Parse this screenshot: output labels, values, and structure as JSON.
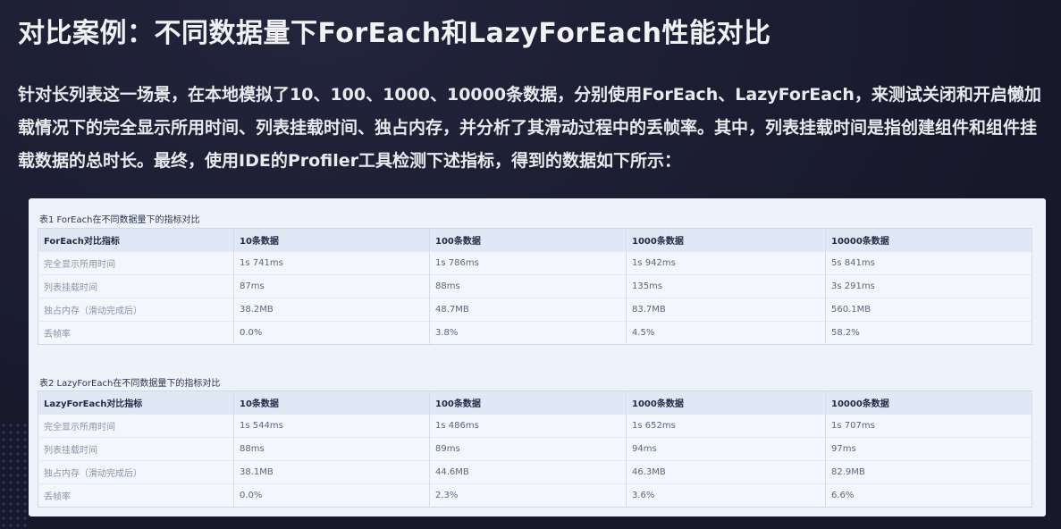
{
  "slide": {
    "title": "对比案例：不同数据量下ForEach和LazyForEach性能对比",
    "body": "针对长列表这一场景，在本地模拟了10、100、1000、10000条数据，分别使用ForEach、LazyForEach，来测试关闭和开启懒加载情况下的完全显示所用时间、列表挂载时间、独占内存，并分析了其滑动过程中的丢帧率。其中，列表挂载时间是指创建组件和组件挂载数据的总时长。最终，使用IDE的Profiler工具检测下述指标，得到的数据如下所示："
  },
  "tables": [
    {
      "caption": "表1 ForEach在不同数据量下的指标对比",
      "headers": [
        "ForEach对比指标",
        "10条数据",
        "100条数据",
        "1000条数据",
        "10000条数据"
      ],
      "rows": [
        [
          "完全显示所用时间",
          "1s 741ms",
          "1s 786ms",
          "1s 942ms",
          "5s 841ms"
        ],
        [
          "列表挂载时间",
          "87ms",
          "88ms",
          "135ms",
          "3s 291ms"
        ],
        [
          "独占内存（滑动完成后）",
          "38.2MB",
          "48.7MB",
          "83.7MB",
          "560.1MB"
        ],
        [
          "丢帧率",
          "0.0%",
          "3.8%",
          "4.5%",
          "58.2%"
        ]
      ]
    },
    {
      "caption": "表2 LazyForEach在不同数据量下的指标对比",
      "headers": [
        "LazyForEach对比指标",
        "10条数据",
        "100条数据",
        "1000条数据",
        "10000条数据"
      ],
      "rows": [
        [
          "完全显示所用时间",
          "1s 544ms",
          "1s 486ms",
          "1s 652ms",
          "1s 707ms"
        ],
        [
          "列表挂载时间",
          "88ms",
          "89ms",
          "94ms",
          "97ms"
        ],
        [
          "独占内存（滑动完成后）",
          "38.1MB",
          "44.6MB",
          "46.3MB",
          "82.9MB"
        ],
        [
          "丢帧率",
          "0.0%",
          "2.3%",
          "3.6%",
          "6.6%"
        ]
      ]
    }
  ]
}
